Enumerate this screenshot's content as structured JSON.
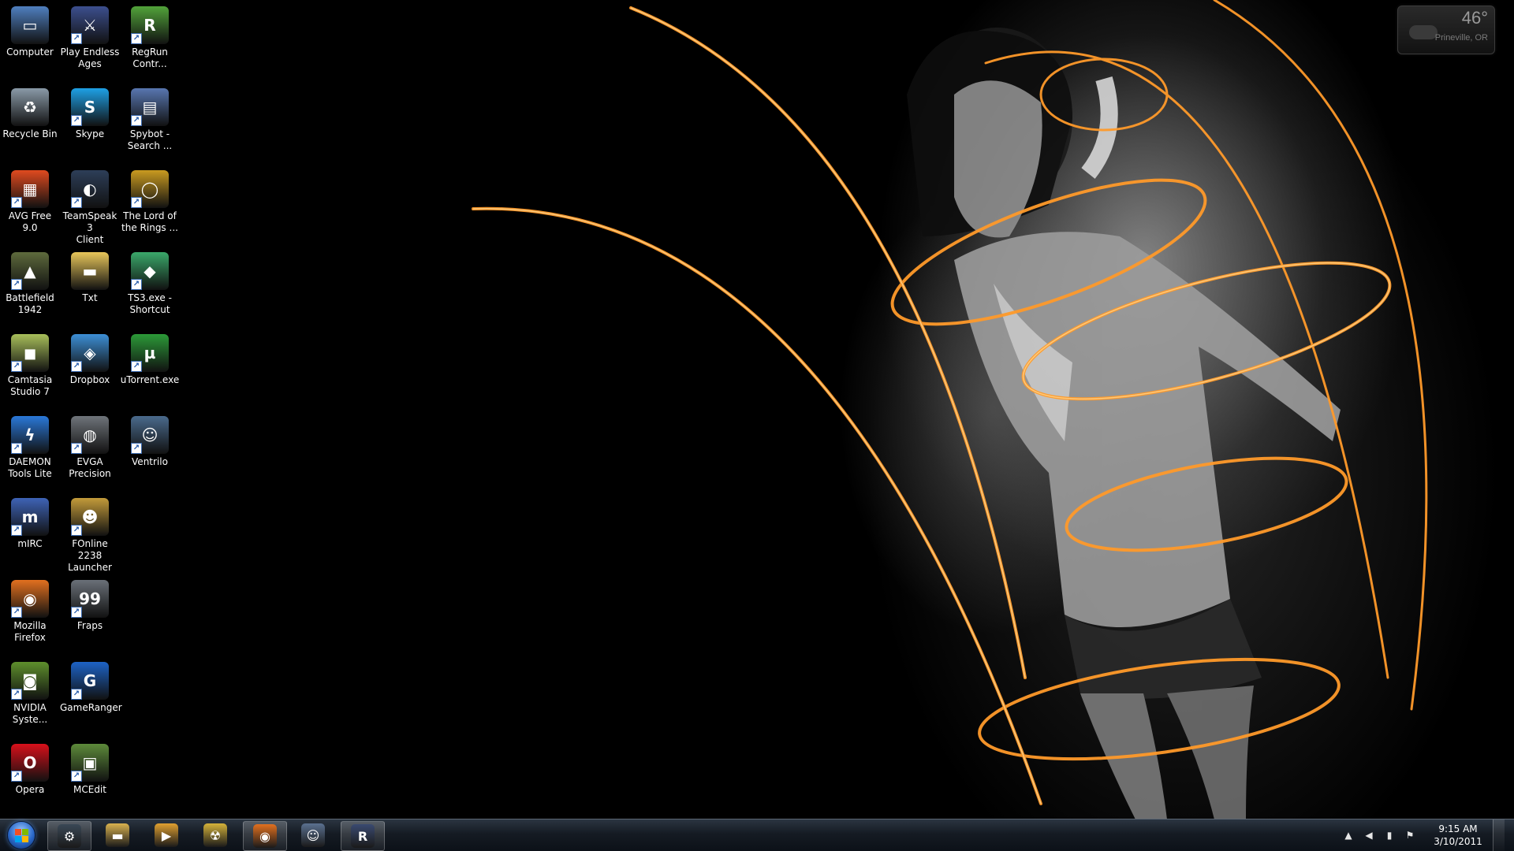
{
  "desktop_icons": [
    {
      "label": "Computer",
      "icon": "computer-icon",
      "color": "#4f7fbf",
      "glyph": "▭"
    },
    {
      "label": "Play Endless\nAges",
      "icon": "endless-ages-icon",
      "color": "#3c4f8e",
      "glyph": "⚔"
    },
    {
      "label": "RegRun\nContr...",
      "icon": "regrun-icon",
      "color": "#52a33a",
      "glyph": "R"
    },
    {
      "label": "Recycle Bin",
      "icon": "recycle-bin-icon",
      "color": "#8a9aa8",
      "glyph": "♻"
    },
    {
      "label": "Skype",
      "icon": "skype-icon",
      "color": "#1ea0e6",
      "glyph": "S"
    },
    {
      "label": "Spybot -\nSearch ...",
      "icon": "spybot-icon",
      "color": "#5876b0",
      "glyph": "▤"
    },
    {
      "label": "AVG Free 9.0",
      "icon": "avg-icon",
      "color": "#e04a1f",
      "glyph": "▦"
    },
    {
      "label": "TeamSpeak 3\nClient",
      "icon": "teamspeak-icon",
      "color": "#2d3e58",
      "glyph": "◐"
    },
    {
      "label": "The Lord of\nthe Rings ...",
      "icon": "lotro-ring-icon",
      "color": "#c99a20",
      "glyph": "◯"
    },
    {
      "label": "Battlefield\n1942",
      "icon": "battlefield-icon",
      "color": "#5e6a3c",
      "glyph": "▲"
    },
    {
      "label": "Txt",
      "icon": "folder-icon",
      "color": "#e8c65a",
      "glyph": "▬"
    },
    {
      "label": "TS3.exe -\nShortcut",
      "icon": "sims3-icon",
      "color": "#3aa86a",
      "glyph": "◆"
    },
    {
      "label": "Camtasia\nStudio 7",
      "icon": "camtasia-icon",
      "color": "#a8bf5a",
      "glyph": "◼"
    },
    {
      "label": "Dropbox",
      "icon": "dropbox-icon",
      "color": "#3d8fd6",
      "glyph": "◈"
    },
    {
      "label": "uTorrent.exe",
      "icon": "utorrent-icon",
      "color": "#2c9a38",
      "glyph": "µ"
    },
    {
      "label": "DAEMON\nTools Lite",
      "icon": "daemon-tools-icon",
      "color": "#2a78d8",
      "glyph": "ϟ"
    },
    {
      "label": "EVGA\nPrecision",
      "icon": "evga-precision-icon",
      "color": "#6f747a",
      "glyph": "◍"
    },
    {
      "label": "Ventrilo",
      "icon": "ventrilo-icon",
      "color": "#4a6a8c",
      "glyph": "☺"
    },
    {
      "label": "mIRC",
      "icon": "mirc-icon",
      "color": "#3e63b6",
      "glyph": "m"
    },
    {
      "label": "FOnline 2238\nLauncher",
      "icon": "fonline-icon",
      "color": "#c39b3a",
      "glyph": "☻"
    },
    {
      "label": "Mozilla\nFirefox",
      "icon": "firefox-icon",
      "color": "#e2701f",
      "glyph": "◉"
    },
    {
      "label": "Fraps",
      "icon": "fraps-icon",
      "color": "#6a7078",
      "glyph": "99"
    },
    {
      "label": "NVIDIA\nSyste...",
      "icon": "nvidia-icon",
      "color": "#5e8f2c",
      "glyph": "◙"
    },
    {
      "label": "GameRanger",
      "icon": "gameranger-icon",
      "color": "#1d63c6",
      "glyph": "G"
    },
    {
      "label": "Opera",
      "icon": "opera-icon",
      "color": "#d8101a",
      "glyph": "O"
    },
    {
      "label": "MCEdit",
      "icon": "mcedit-icon",
      "color": "#5d8a3a",
      "glyph": "▣"
    }
  ],
  "weather": {
    "temperature": "46°",
    "location": "Prineville, OR"
  },
  "taskbar": {
    "items": [
      {
        "name": "steam",
        "icon": "steam-icon",
        "color": "#3a4856",
        "glyph": "⚙",
        "active": true
      },
      {
        "name": "windows-explorer",
        "icon": "folder-icon",
        "color": "#d9b24f",
        "glyph": "▬",
        "active": false
      },
      {
        "name": "media-player",
        "icon": "media-player-icon",
        "color": "#e0a030",
        "glyph": "▶",
        "active": false
      },
      {
        "name": "fallout-app",
        "icon": "radiation-icon",
        "color": "#d4b23a",
        "glyph": "☢",
        "active": false
      },
      {
        "name": "firefox",
        "icon": "firefox-icon",
        "color": "#e2701f",
        "glyph": "◉",
        "active": true
      },
      {
        "name": "ventrilo",
        "icon": "ventrilo-icon",
        "color": "#5a7090",
        "glyph": "☺",
        "active": false
      },
      {
        "name": "lotro-launcher",
        "icon": "lotro-icon",
        "color": "#3a4a70",
        "glyph": "R",
        "active": true
      }
    ]
  },
  "tray": {
    "icons": [
      "show-hidden-icons-icon",
      "volume-icon",
      "network-signal-icon",
      "action-center-flag-icon"
    ],
    "glyphs": [
      "▲",
      "◀",
      "▮",
      "⚑"
    ],
    "time": "9:15 AM",
    "date": "3/10/2011"
  }
}
